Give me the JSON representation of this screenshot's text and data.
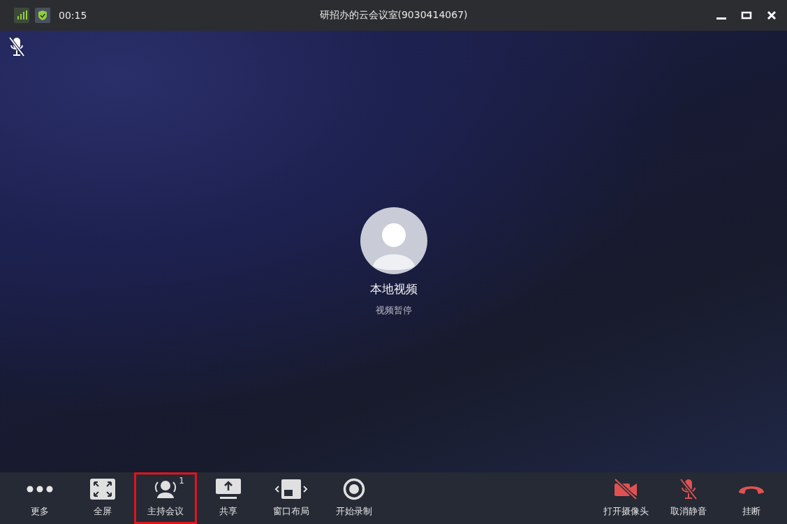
{
  "status": {
    "time": "00:15"
  },
  "window": {
    "title": "研招办的云会议室(9030414067)"
  },
  "self_mic_muted": true,
  "participant": {
    "name": "本地视频",
    "status": "视频暂停"
  },
  "toolbar_left": [
    {
      "kind": "more",
      "label": "更多",
      "highlighted": false
    },
    {
      "kind": "fullscreen",
      "label": "全屏",
      "highlighted": false
    },
    {
      "kind": "host",
      "label": "主持会议",
      "badge": "1",
      "highlighted": true
    },
    {
      "kind": "share",
      "label": "共享",
      "highlighted": false
    },
    {
      "kind": "layout",
      "label": "窗口布局",
      "highlighted": false
    },
    {
      "kind": "record",
      "label": "开始录制",
      "highlighted": false
    }
  ],
  "toolbar_right": [
    {
      "kind": "camera-off",
      "label": "打开摄像头",
      "highlighted": false
    },
    {
      "kind": "mic-off",
      "label": "取消静音",
      "highlighted": false
    },
    {
      "kind": "hangup",
      "label": "挂断",
      "highlighted": false
    }
  ]
}
